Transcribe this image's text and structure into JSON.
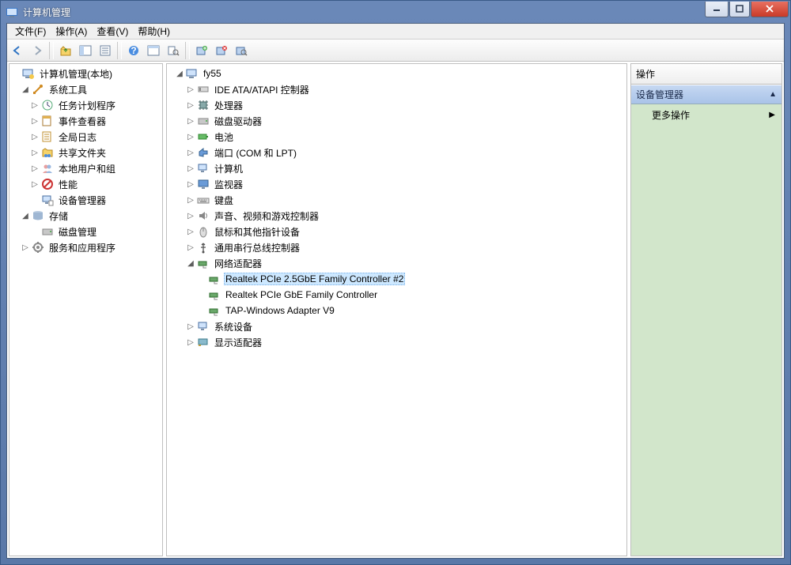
{
  "window": {
    "title": "计算机管理"
  },
  "menu": {
    "file": "文件(F)",
    "action": "操作(A)",
    "view": "查看(V)",
    "help": "帮助(H)"
  },
  "left_tree": {
    "root": "计算机管理(本地)",
    "system_tools": "系统工具",
    "task_scheduler": "任务计划程序",
    "event_viewer": "事件查看器",
    "global_log": "全局日志",
    "shared_folders": "共享文件夹",
    "local_users": "本地用户和组",
    "performance": "性能",
    "device_manager": "设备管理器",
    "storage": "存储",
    "disk_management": "磁盘管理",
    "services_apps": "服务和应用程序"
  },
  "center_tree": {
    "root": "fy55",
    "ide": "IDE ATA/ATAPI 控制器",
    "cpu": "处理器",
    "disk": "磁盘驱动器",
    "battery": "电池",
    "ports": "端口 (COM 和 LPT)",
    "computer": "计算机",
    "monitor": "监视器",
    "keyboard": "键盘",
    "sound": "声音、视频和游戏控制器",
    "mouse": "鼠标和其他指针设备",
    "usb": "通用串行总线控制器",
    "network": "网络适配器",
    "net_items": {
      "a": "Realtek PCIe 2.5GbE Family Controller #2",
      "b": "Realtek PCIe GbE Family Controller",
      "c": "TAP-Windows Adapter V9"
    },
    "system_devices": "系统设备",
    "display": "显示适配器"
  },
  "right": {
    "header": "操作",
    "section": "设备管理器",
    "more": "更多操作"
  }
}
